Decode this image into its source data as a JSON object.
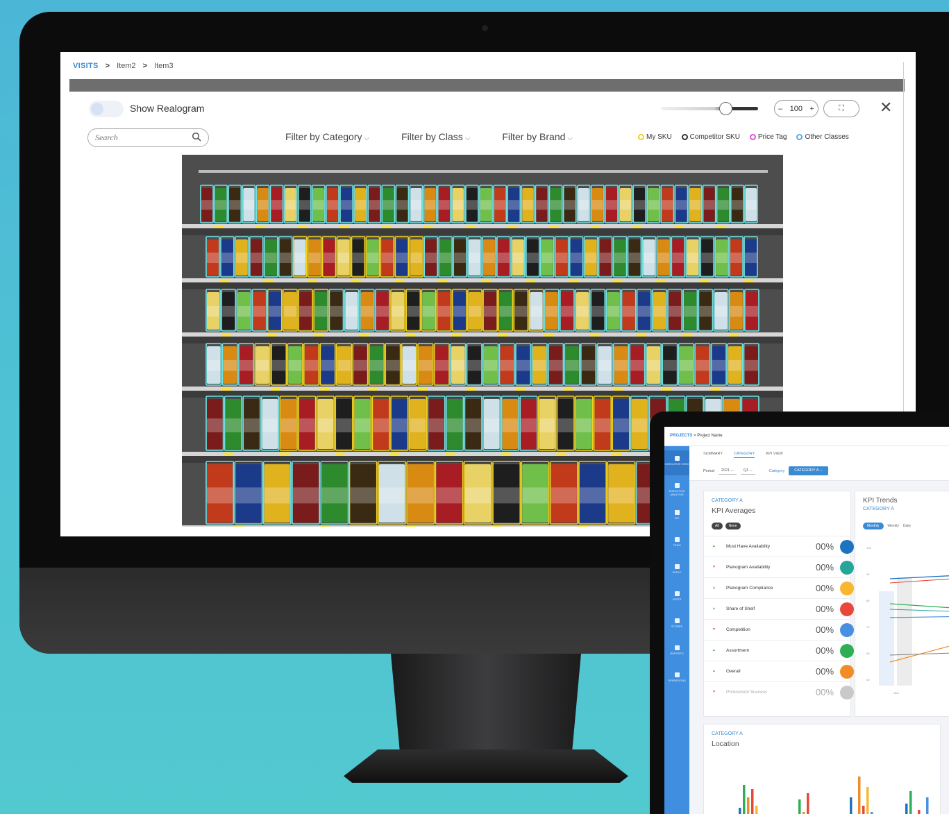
{
  "breadcrumb": {
    "root": "VISITS",
    "items": [
      "Item2",
      "Item3"
    ]
  },
  "toolbar": {
    "show_realogram_label": "Show Realogram",
    "zoom_minus": "–",
    "zoom_value": "100",
    "zoom_plus": "+",
    "zoom_slider_level": 0.6,
    "fullscreen_icon": "⛶",
    "close_icon": "✕"
  },
  "search": {
    "placeholder": "Search"
  },
  "filters": {
    "category": "Filter by Category",
    "class": "Filter by Class",
    "brand": "Filter by Brand"
  },
  "legend": [
    {
      "label": "My SKU",
      "color": "#f2d21b"
    },
    {
      "label": "Competitor SKU",
      "color": "#333333"
    },
    {
      "label": "Price Tag",
      "color": "#e04fd6"
    },
    {
      "label": "Other Classes",
      "color": "#5aa9e6"
    }
  ],
  "realogram": {
    "box_colors": {
      "competitor": "#6fe3e3",
      "my_sku": "#f2d21b"
    }
  },
  "tablet": {
    "breadcrumb": {
      "root": "PROJECTS",
      "item": "Project Name"
    },
    "tabs": [
      "SUMMARY",
      "CATEGORY",
      "KPI VIEW"
    ],
    "active_tab": "CATEGORY",
    "period_label": "Period",
    "year": "2021",
    "quarter": "Q1",
    "category_label": "Category",
    "category_value": "CATEGORY A",
    "nav": [
      "EXECUTIVE VIEW",
      "EXECUTIVE ANALYSIS",
      "KPI",
      "TEAM",
      "SHELF",
      "VISITS",
      "STORES",
      "REPORTS",
      "OPERATIONS"
    ],
    "kpi_card": {
      "subtitle": "CATEGORY A",
      "title": "KPI Averages",
      "chips": [
        "All",
        "None"
      ],
      "rows": [
        {
          "label": "Must Have Availability",
          "value": "00%",
          "color": "#1e73be"
        },
        {
          "label": "Planogram Availability",
          "value": "00%",
          "color": "#26a69a"
        },
        {
          "label": "Planogram Compliance",
          "value": "00%",
          "color": "#f7b731"
        },
        {
          "label": "Share of Shelf",
          "value": "00%",
          "color": "#e8483b"
        },
        {
          "label": "Competition",
          "value": "00%",
          "color": "#4a90e2"
        },
        {
          "label": "Assortment",
          "value": "00%",
          "color": "#2fae53"
        },
        {
          "label": "Overall",
          "value": "00%",
          "color": "#f28c28"
        },
        {
          "label": "Photoshoot Success",
          "value": "00%",
          "color": "#c9c9c9"
        }
      ]
    },
    "trends_card": {
      "title": "KPI Trends",
      "subtitle": "CATEGORY A",
      "intervals": [
        "Monthly",
        "Weekly",
        "Daily"
      ],
      "y_ticks": [
        "100",
        "90",
        "80",
        "70",
        "60",
        "50"
      ],
      "x_tick": "JAN"
    },
    "location_card": {
      "subtitle": "CATEGORY A",
      "title": "Location"
    }
  }
}
